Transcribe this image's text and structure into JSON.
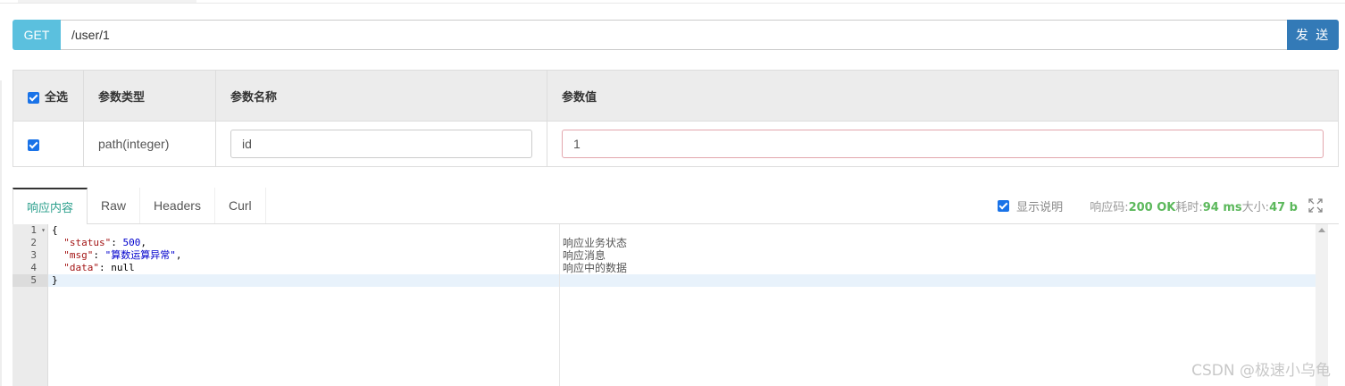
{
  "request": {
    "method": "GET",
    "url": "/user/1",
    "send_label": "发 送"
  },
  "params": {
    "headers": {
      "select_all": "全选",
      "type": "参数类型",
      "name": "参数名称",
      "value": "参数值"
    },
    "rows": [
      {
        "checked": true,
        "type": "path(integer)",
        "name": "id",
        "value": "1"
      }
    ]
  },
  "response": {
    "tabs": [
      "响应内容",
      "Raw",
      "Headers",
      "Curl"
    ],
    "active_tab": "响应内容",
    "show_desc_label": "显示说明",
    "show_desc_checked": true,
    "status_label": "响应码:",
    "status_value": "200 OK",
    "time_label": "耗时:",
    "time_value": "94 ms",
    "size_label": "大小:",
    "size_value": "47 b",
    "line_numbers": [
      "1",
      "2",
      "3",
      "4",
      "5"
    ],
    "lines": [
      {
        "text": "{"
      },
      {
        "key": "\"status\"",
        "value": "500",
        "suffix": ","
      },
      {
        "key": "\"msg\"",
        "value": "\"算数运算异常\"",
        "suffix": ","
      },
      {
        "key": "\"data\"",
        "value": "null",
        "suffix": ""
      },
      {
        "text": "}"
      }
    ],
    "descriptions": [
      "响应业务状态",
      "响应消息",
      "响应中的数据"
    ]
  },
  "watermark": "CSDN @极速小乌龟",
  "colors": {
    "method_bg": "#5bc0de",
    "send_bg": "#337ab7",
    "active_tab_text": "#2b9f8c",
    "status_value": "#5cb85c"
  }
}
